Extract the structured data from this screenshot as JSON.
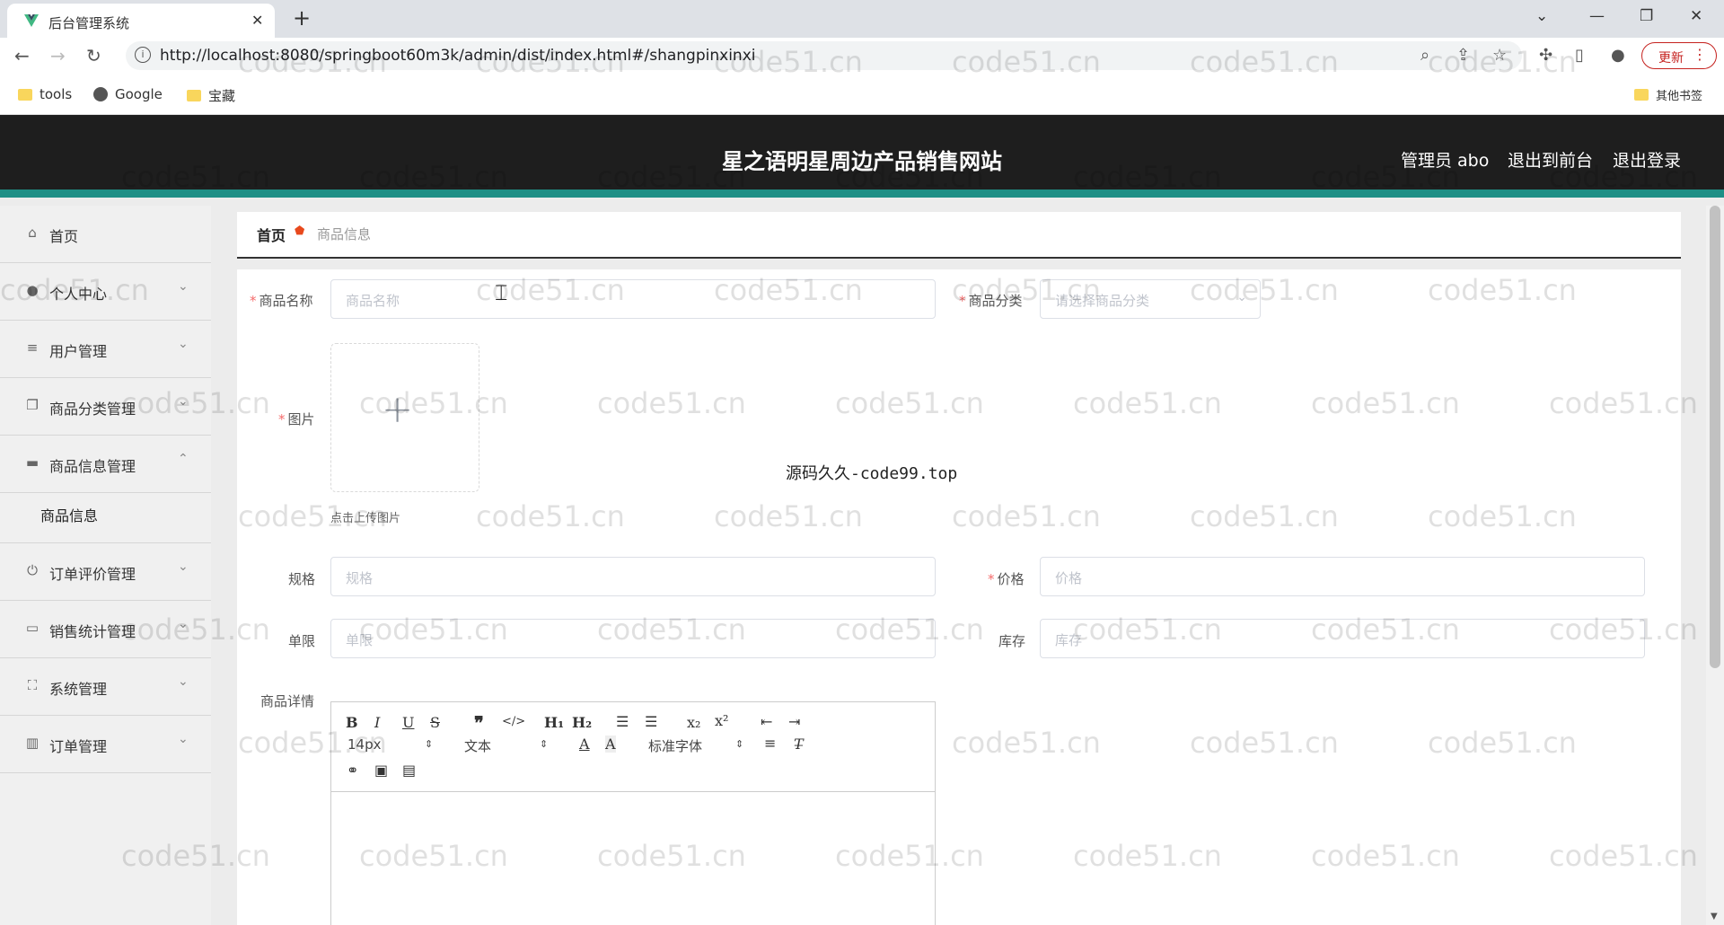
{
  "browser": {
    "tab_title": "后台管理系统",
    "url": "http://localhost:8080/springboot60m3k/admin/dist/index.html#/shangpinxinxi",
    "update_label": "更新",
    "bookmarks": [
      "tools",
      "Google",
      "宝藏"
    ],
    "other_bookmarks": "其他书签"
  },
  "header": {
    "title": "星之语明星周边产品销售网站",
    "user": "管理员 abo",
    "back_front": "退出到前台",
    "logout": "退出登录",
    "accent_color": "#1f8f86"
  },
  "sidebar": {
    "items": [
      {
        "label": "首页",
        "icon": "home-icon"
      },
      {
        "label": "个人中心",
        "icon": "user-icon"
      },
      {
        "label": "用户管理",
        "icon": "list-icon"
      },
      {
        "label": "商品分类管理",
        "icon": "copy-icon"
      },
      {
        "label": "商品信息管理",
        "icon": "briefcase-icon"
      },
      {
        "label": "订单评价管理",
        "icon": "power-icon"
      },
      {
        "label": "销售统计管理",
        "icon": "monitor-icon"
      },
      {
        "label": "系统管理",
        "icon": "fullscreen-icon"
      },
      {
        "label": "订单管理",
        "icon": "chart-icon"
      }
    ],
    "submenu": "商品信息"
  },
  "breadcrumb": {
    "home": "首页",
    "current": "商品信息"
  },
  "form": {
    "name_label": "商品名称",
    "name_placeholder": "商品名称",
    "category_label": "商品分类",
    "category_placeholder": "请选择商品分类",
    "image_label": "图片",
    "upload_tip": "点击上传图片",
    "spec_label": "规格",
    "spec_placeholder": "规格",
    "price_label": "价格",
    "price_placeholder": "价格",
    "limit_label": "单限",
    "limit_placeholder": "单限",
    "stock_label": "库存",
    "stock_placeholder": "库存",
    "detail_label": "商品详情"
  },
  "editor": {
    "size": "14px",
    "text": "文本",
    "font": "标准字体"
  },
  "watermark_center": "源码久久-code99.top",
  "watermark": "code51.cn"
}
